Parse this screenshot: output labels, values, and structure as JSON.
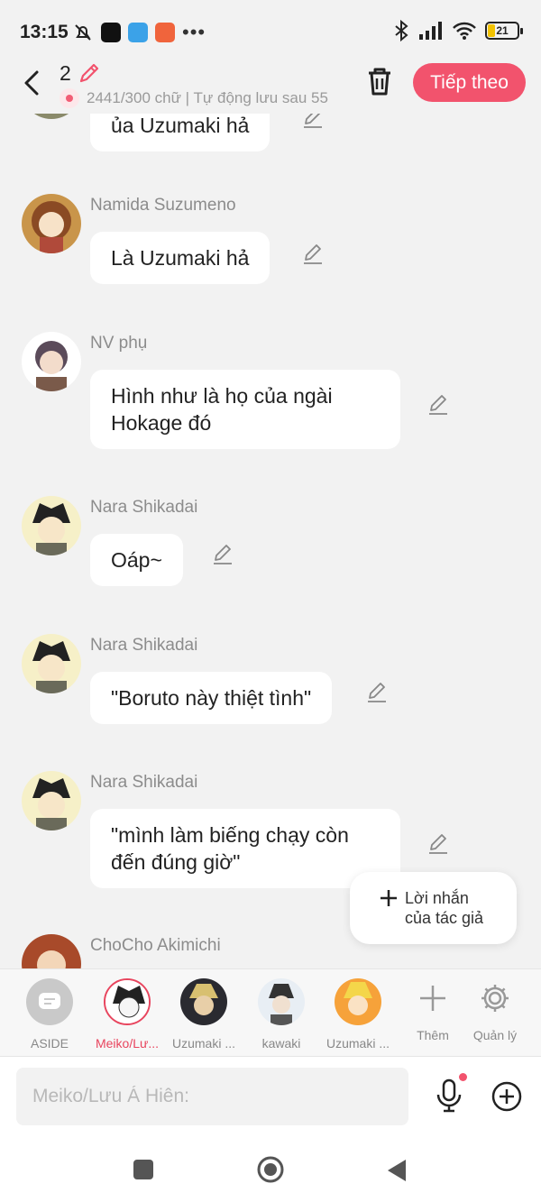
{
  "status_bar": {
    "time": "13:15",
    "battery": "21"
  },
  "header": {
    "chapter_number": "2",
    "count_text": "2441/300 chữ | Tự động lưu sau 55",
    "next_label": "Tiếp theo"
  },
  "messages": [
    {
      "name": "",
      "text": "ủa Uzumaki hả"
    },
    {
      "name": "Namida Suzumeno",
      "text": "Là Uzumaki hả"
    },
    {
      "name": "NV phụ",
      "text": "Hình như là họ của ngài Hokage đó"
    },
    {
      "name": "Nara Shikadai",
      "text": "Oáp~"
    },
    {
      "name": "Nara Shikadai",
      "text": "\"Boruto này thiệt tình\""
    },
    {
      "name": "Nara Shikadai",
      "text": "\"mình làm biếng chạy còn đến đúng giờ\""
    },
    {
      "name": "ChoCho Akimichi",
      "text": ""
    }
  ],
  "fab": {
    "label": "Lời nhắn của tác giả"
  },
  "characters": [
    {
      "label": "ASIDE"
    },
    {
      "label": "Meiko/Lư..."
    },
    {
      "label": "Uzumaki ..."
    },
    {
      "label": "kawaki"
    },
    {
      "label": "Uzumaki ..."
    }
  ],
  "tools": {
    "add_label": "Thêm",
    "manage_label": "Quản lý"
  },
  "input": {
    "placeholder": "Meiko/Lưu Á Hiên:"
  },
  "colors": {
    "accent": "#f2536d",
    "background": "#f2f2f2"
  },
  "icons": [
    "back-icon",
    "edit-icon",
    "trash-icon",
    "plus-icon",
    "gear-icon",
    "mic-icon",
    "plus-circle-icon"
  ]
}
